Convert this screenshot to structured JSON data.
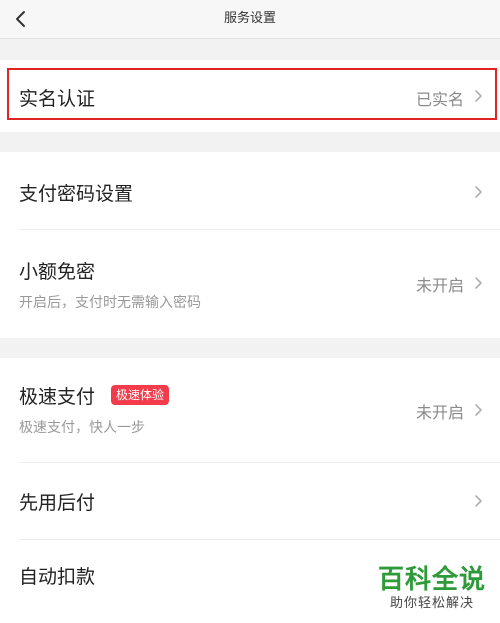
{
  "nav": {
    "back_icon": "chevron-left-icon",
    "title": "服务设置"
  },
  "groups": [
    {
      "rows": [
        {
          "title": "实名认证",
          "value": "已实名"
        }
      ]
    },
    {
      "rows": [
        {
          "title": "支付密码设置",
          "value": ""
        },
        {
          "title": "小额免密",
          "subtitle": "开启后，支付时无需输入密码",
          "value": "未开启"
        }
      ]
    },
    {
      "rows": [
        {
          "title": "极速支付",
          "badge": "极速体验",
          "subtitle": "极速支付，快人一步",
          "value": "未开启"
        },
        {
          "title": "先用后付",
          "value": ""
        },
        {
          "title": "自动扣款",
          "value": ""
        }
      ]
    }
  ],
  "watermark": {
    "main": "百科全说",
    "sub": "助你轻松解决"
  },
  "colors": {
    "highlight_border": "#e02424",
    "badge_bg": "#f23c4b",
    "watermark_green": "#2f9a3a"
  }
}
